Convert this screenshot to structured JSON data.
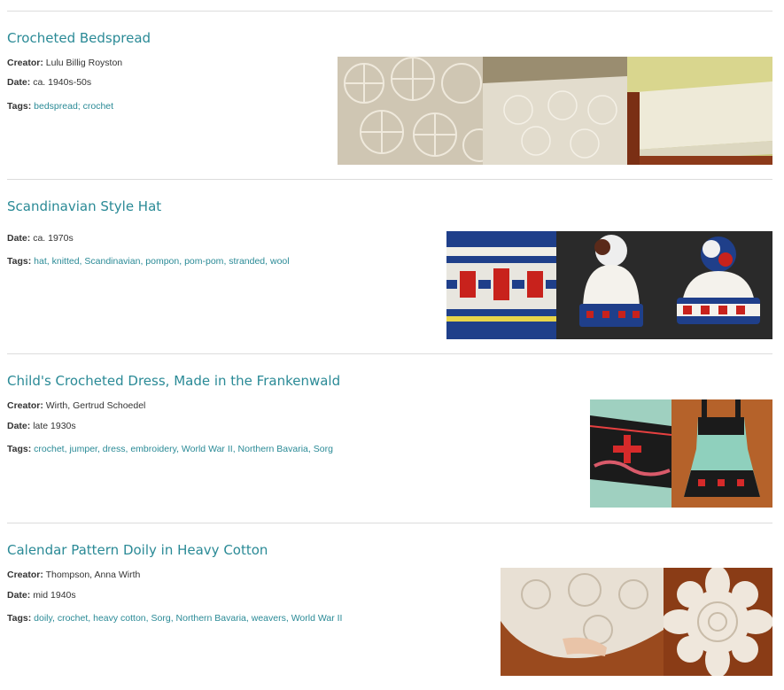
{
  "items": [
    {
      "title": "Crocheted Bedspread",
      "creator_label": "Creator:",
      "creator": "Lulu Billig Royston",
      "date_label": "Date:",
      "date": "ca. 1940s-50s",
      "tags_label": "Tags:",
      "tags": [
        "bedspread",
        "crochet"
      ],
      "tag_separator": "; ",
      "images": [
        "crochet-closeup",
        "bedspread-on-bed",
        "bed-side-view"
      ]
    },
    {
      "title": "Scandinavian Style Hat",
      "date_label": "Date:",
      "date": "ca. 1970s",
      "tags_label": "Tags:",
      "tags": [
        "hat",
        "knitted",
        "Scandinavian",
        "pompon",
        "pom-pom",
        "stranded",
        "wool"
      ],
      "tag_separator": ", ",
      "images": [
        "knit-pattern-closeup",
        "hat-front",
        "hat-side"
      ]
    },
    {
      "title": "Child's Crocheted Dress, Made in the Frankenwald",
      "creator_label": "Creator:",
      "creator": "Wirth, Gertrud Schoedel",
      "date_label": "Date:",
      "date": "late 1930s",
      "tags_label": "Tags:",
      "tags": [
        "crochet",
        "jumper",
        "dress",
        "embroidery",
        "World War II",
        "Northern Bavaria",
        "Sorg"
      ],
      "tag_separator": ", ",
      "images": [
        "embroidery-closeup",
        "dress-full"
      ]
    },
    {
      "title": "Calendar Pattern Doily in Heavy Cotton",
      "creator_label": "Creator:",
      "creator": "Thompson, Anna Wirth",
      "date_label": "Date:",
      "date": "mid 1940s",
      "tags_label": "Tags:",
      "tags": [
        "doily",
        "crochet",
        "heavy cotton",
        "Sorg",
        "Northern Bavaria",
        "weavers",
        "World War II"
      ],
      "tag_separator": ", ",
      "images": [
        "doily-with-hand",
        "doily-flower"
      ]
    }
  ]
}
